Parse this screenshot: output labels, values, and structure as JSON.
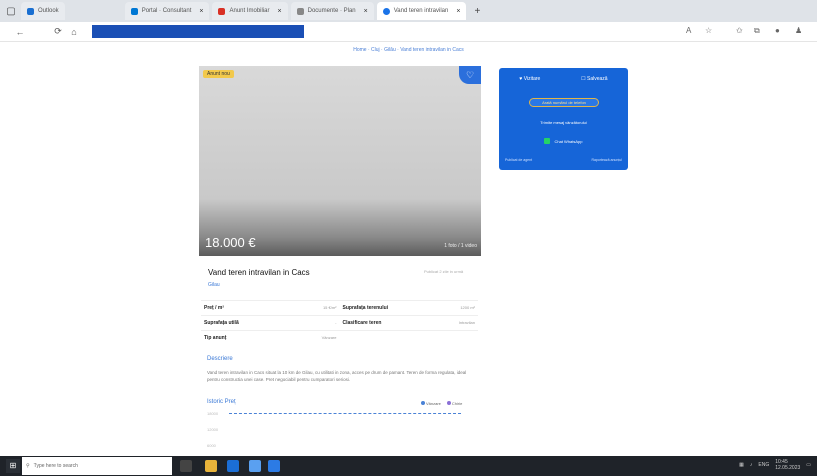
{
  "tabs": [
    {
      "label": "Outlook",
      "favColor": "#1a6fd1"
    },
    {
      "label": "Portal · Consultant",
      "favColor": "#0078d4"
    },
    {
      "label": "Anunt Imobiliar",
      "favColor": "#d93025"
    },
    {
      "label": "Documente · Plan",
      "favColor": "#888888"
    },
    {
      "label": "Vand teren intravilan",
      "favColor": "#1a73e8",
      "active": true
    }
  ],
  "breadcrumbs": "Home · Cluj · Gilău · Vand teren intravilan in Cacs",
  "listing": {
    "badge": "Anunt nou",
    "price": "18.000 €",
    "photo_count": "1 foto / 1 video",
    "title": "Vand teren intravilan in Cacs",
    "location": "Gilau",
    "posted": "Publicat 2 zile in urmă"
  },
  "panel": {
    "views_label": "Vizitare",
    "save_label": "Salvează",
    "phone_btn": "Arată numărul de telefon",
    "message_btn": "Trimite mesaj vânzătorului",
    "whatsapp_btn": "Chat WhatsApp",
    "footer_left": "Publicat de agent",
    "footer_right": "Raportează anunțul"
  },
  "specs": [
    {
      "l_label": "Preț / m²",
      "l_value": "15 €/m²",
      "r_label": "Suprafața terenului",
      "r_value": "1200 m²"
    },
    {
      "l_label": "Suprafața utilă",
      "l_value": "-",
      "r_label": "Clasificare teren",
      "r_value": "Intravilan"
    },
    {
      "l_label": "Tip anunț",
      "l_value": "Vânzare",
      "r_label": "",
      "r_value": ""
    }
  ],
  "description": {
    "title": "Descriere",
    "text": "Vand teren intravilan in Cacs situat la 10 km de Gilau, cu utilitati in zona, acces pe drum de pamant. Teren de forma regulata, ideal pentru constructia unei case. Pret negociabil pentru cumparatori seriosi."
  },
  "history": {
    "title": "Istoric Preț",
    "legend_a": "Vânzare",
    "legend_b": "Chirie",
    "color_a": "#4a82d6",
    "color_b": "#8a6fd6",
    "y_ticks": [
      "18000",
      "12000",
      "6000"
    ]
  },
  "taskbar": {
    "search_placeholder": "Type here to search",
    "time": "10:45",
    "date": "12.05.2023",
    "lang": "ENG"
  }
}
